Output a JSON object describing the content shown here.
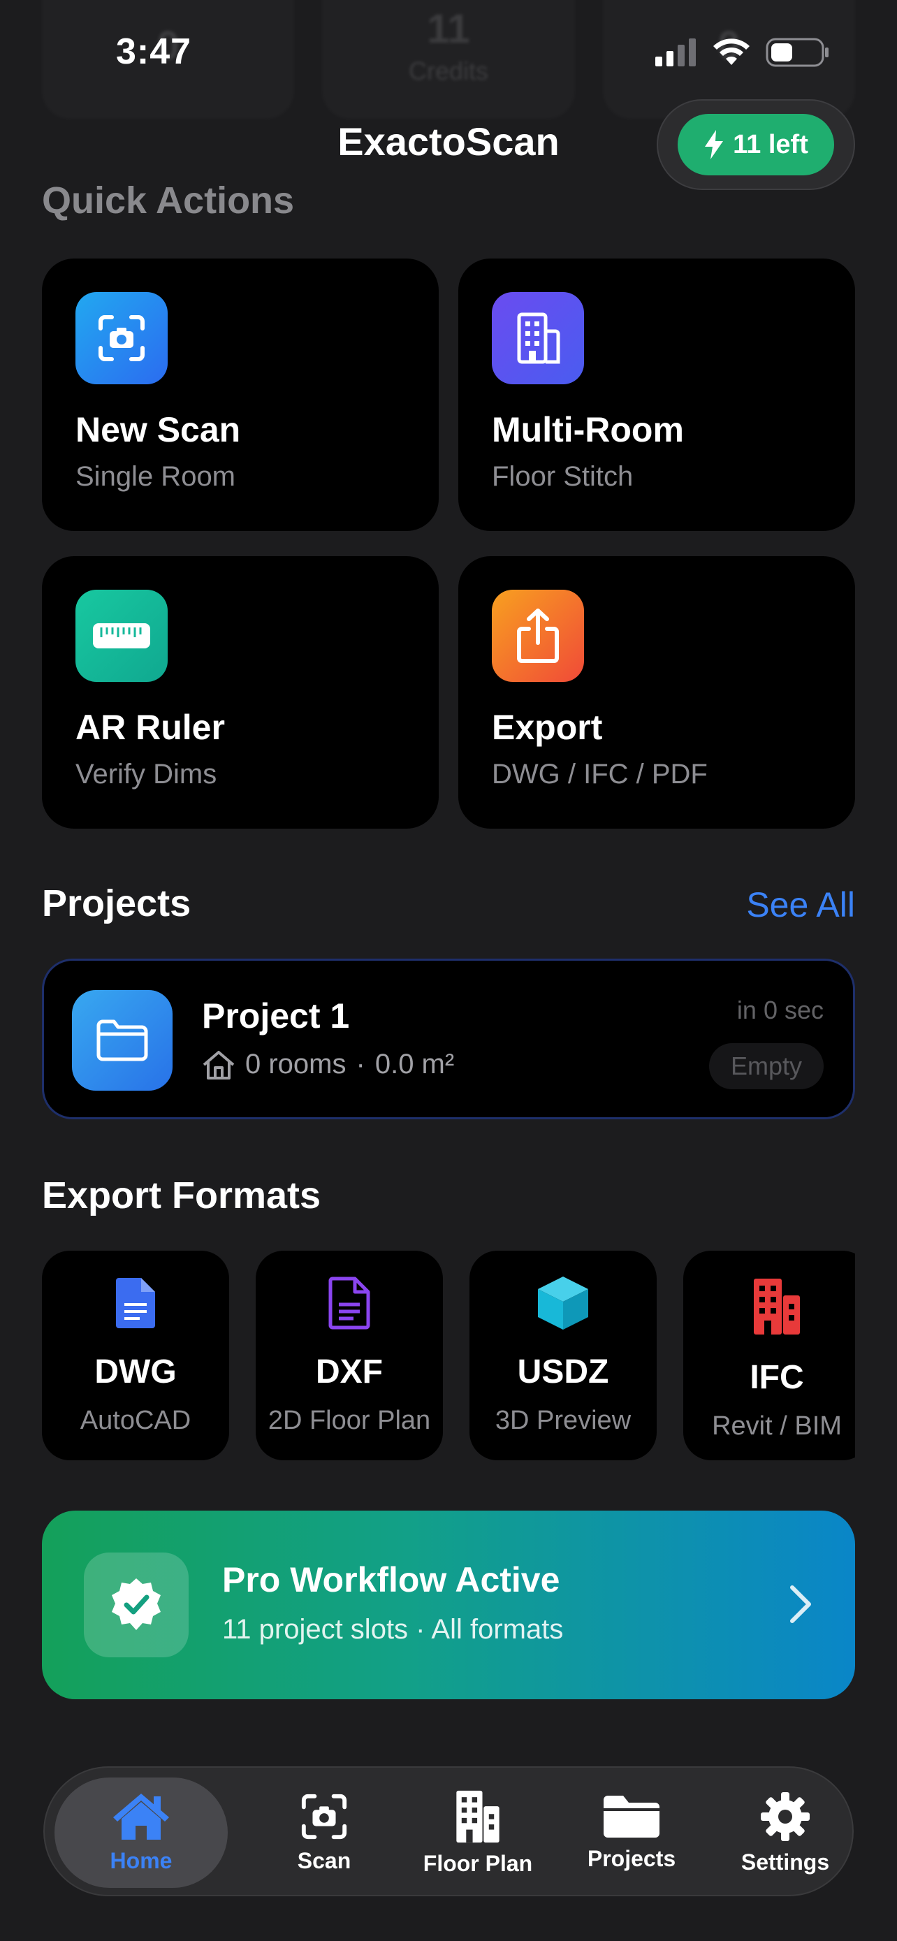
{
  "status_bar": {
    "time": "3:47"
  },
  "background_stats": [
    {
      "value": "0",
      "label": ""
    },
    {
      "value": "11",
      "label": "Credits"
    },
    {
      "value": "0",
      "label": ""
    }
  ],
  "header": {
    "title": "ExactoScan",
    "credits_label": "11 left"
  },
  "quick_actions": {
    "title": "Quick Actions",
    "items": [
      {
        "title": "New Scan",
        "subtitle": "Single Room",
        "icon": "camera-scan-icon",
        "color": "#2b8cf0"
      },
      {
        "title": "Multi-Room",
        "subtitle": "Floor Stitch",
        "icon": "building-icon",
        "color": "#6a4cf0"
      },
      {
        "title": "AR Ruler",
        "subtitle": "Verify Dims",
        "icon": "ruler-icon",
        "color": "#14b89a"
      },
      {
        "title": "Export",
        "subtitle": "DWG / IFC / PDF",
        "icon": "share-icon",
        "color": "#f25a28"
      }
    ]
  },
  "projects": {
    "title": "Projects",
    "see_all": "See All",
    "items": [
      {
        "name": "Project 1",
        "rooms": "0 rooms",
        "separator": "·",
        "area": "0.0 m²",
        "time": "in 0 sec",
        "status": "Empty"
      }
    ]
  },
  "export_formats": {
    "title": "Export Formats",
    "items": [
      {
        "name": "DWG",
        "subtitle": "AutoCAD",
        "icon": "document-icon",
        "color": "#3b6cf0"
      },
      {
        "name": "DXF",
        "subtitle": "2D Floor Plan",
        "icon": "document-outline-icon",
        "color": "#8b45f0"
      },
      {
        "name": "USDZ",
        "subtitle": "3D Preview",
        "icon": "cube-icon",
        "color": "#18b8d8"
      },
      {
        "name": "IFC",
        "subtitle": "Revit / BIM",
        "icon": "building-icon",
        "color": "#e83a3a"
      }
    ]
  },
  "pro_banner": {
    "title": "Pro Workflow Active",
    "subtitle": "11 project slots · All formats"
  },
  "tab_bar": {
    "active": "Home",
    "tabs": [
      {
        "label": "Home",
        "icon": "house-icon"
      },
      {
        "label": "Scan",
        "icon": "camera-scan-icon"
      },
      {
        "label": "Floor Plan",
        "icon": "building-icon"
      },
      {
        "label": "Projects",
        "icon": "folder-icon"
      },
      {
        "label": "Settings",
        "icon": "gear-icon"
      }
    ]
  },
  "colors": {
    "background": "#1c1c1e",
    "accent_blue": "#3b82f6",
    "credits_green": "#1fae6f"
  }
}
